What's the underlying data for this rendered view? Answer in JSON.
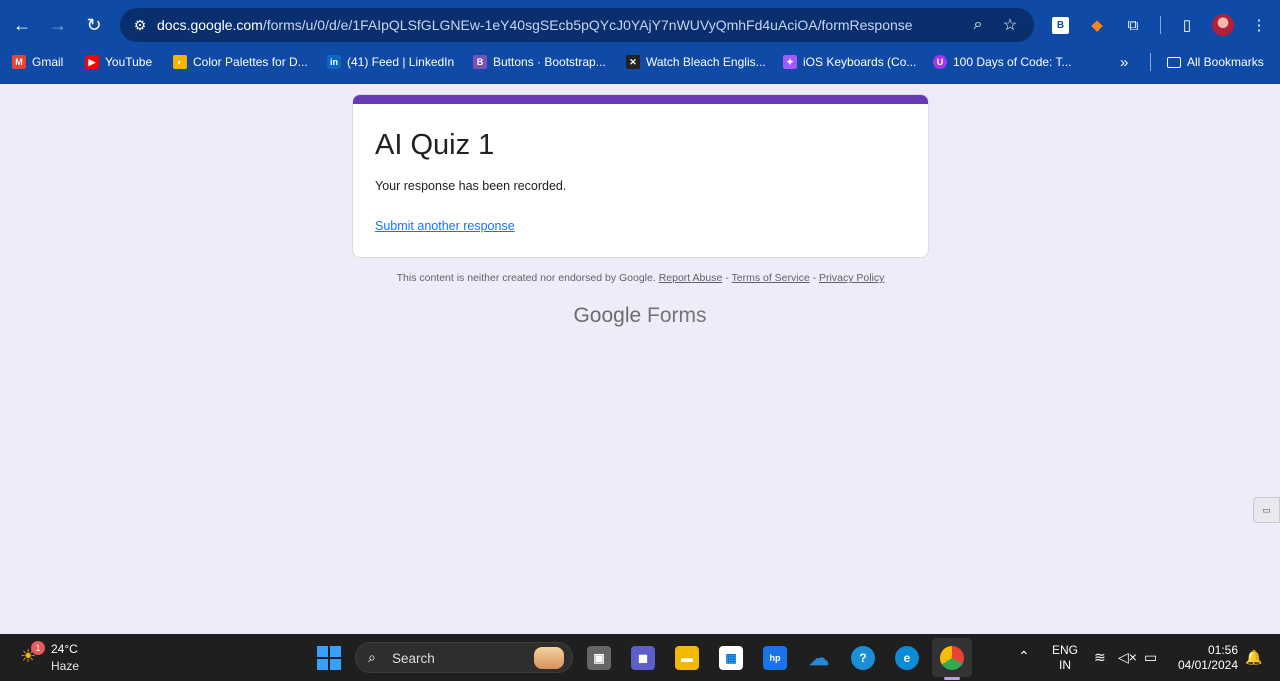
{
  "browser": {
    "url_host": "docs.google.com",
    "url_path": "/forms/u/0/d/e/1FAIpQLSfGLGNEw-1eY40sgSEcb5pQYcJ0YAjY7nWUVyQmhFd4uAciOA/formResponse",
    "extension_b_label": "B",
    "bookmarks": [
      {
        "label": "Gmail",
        "icon": "gmail-icon",
        "color": "#ea4335"
      },
      {
        "label": "YouTube",
        "icon": "youtube-icon",
        "color": "#ff0000"
      },
      {
        "label": "Color Palettes for D...",
        "icon": "palette-icon",
        "color": "#f4b400"
      },
      {
        "label": "(41) Feed | LinkedIn",
        "icon": "linkedin-icon",
        "color": "#0a66c2"
      },
      {
        "label": "Buttons · Bootstrap...",
        "icon": "bootstrap-icon",
        "color": "#7952b3"
      },
      {
        "label": "Watch Bleach Englis...",
        "icon": "anime-icon",
        "color": "#222222"
      },
      {
        "label": "iOS Keyboards (Co...",
        "icon": "figma-icon",
        "color": "#a259ff"
      },
      {
        "label": "100 Days of Code: T...",
        "icon": "course-icon",
        "color": "#a435f0"
      }
    ],
    "overflow_label": "»",
    "all_bookmarks_label": "All Bookmarks"
  },
  "form": {
    "title": "AI Quiz 1",
    "confirmation": "Your response has been recorded.",
    "submit_another": "Submit another response",
    "accent_color": "#673ab7"
  },
  "footer": {
    "disclaimer": "This content is neither created nor endorsed by Google.",
    "report_abuse": "Report Abuse",
    "terms": "Terms of Service",
    "privacy": "Privacy Policy",
    "separator": " - ",
    "brand_google": "Google",
    "brand_forms": "Forms"
  },
  "taskbar": {
    "weather_badge": "1",
    "temperature": "24°C",
    "condition": "Haze",
    "search_label": "Search",
    "lang_line1": "ENG",
    "lang_line2": "IN",
    "time": "01:56",
    "date": "04/01/2024"
  }
}
